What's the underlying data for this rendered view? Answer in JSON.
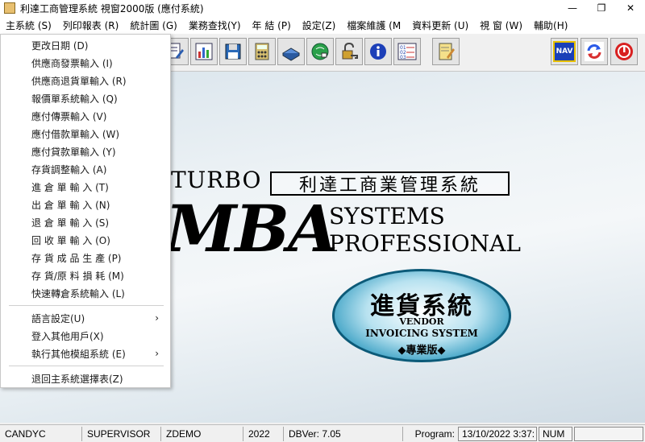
{
  "window": {
    "title": "利達工商管理系統 視窗2000版 (應付系統)",
    "minimize": "—",
    "maximize": "❐",
    "close": "✕"
  },
  "menubar": [
    "主系統 (S)",
    "列印報表 (R)",
    "統計圖 (G)",
    "業務查找(Y)",
    "年 結 (P)",
    "設定(Z)",
    "檔案維護 (M",
    "資料更新 (U)",
    "視 窗 (W)",
    "輔助(H)"
  ],
  "dropdown": {
    "items": [
      "更改日期 (D)",
      "供應商發票輸入 (I)",
      "供應商退貨單輸入 (R)",
      "報價單系統輸入 (Q)",
      "應付傳票輸入 (V)",
      "應付借款單輸入 (W)",
      "應付貸款單輸入 (Y)",
      "存貨調整輸入 (A)",
      "進 倉 單 輸 入 (T)",
      "出 倉 單 輸 入 (N)",
      "退 倉 單 輸 入 (S)",
      "回 收 單 輸 入 (O)",
      "存 貨 成 品 生 產 (P)",
      "存 貨/原 料 損 耗 (M)",
      "快速轉倉系統輸入 (L)"
    ],
    "sub_items": [
      "語言設定(U)",
      "登入其他用戶(X)",
      "執行其他模組系統 (E)"
    ],
    "last_item": "退回主系統選擇表(Z)",
    "submenu_arrow": "›"
  },
  "toolbar": {
    "icons": [
      "document-icon",
      "chart-icon",
      "diskette-icon",
      "calculator-icon",
      "printer-icon",
      "globe-icon",
      "lock-icon",
      "info-icon",
      "list-icon",
      "notepad-icon"
    ],
    "nav_label": "NAV",
    "right_icons": [
      "nav-icon",
      "refresh-icon",
      "exit-icon"
    ]
  },
  "splash": {
    "turbo": "TURBO",
    "cn_title": "利達工商業管理系統",
    "mba": "MBA",
    "systems": "SYSTEMS",
    "professional": "PROFESSIONAL",
    "module_cn": "進貨系統",
    "module_en1": "VENDOR",
    "module_en2": "INVOICING SYSTEM",
    "edition": "◆專業版◆"
  },
  "statusbar": {
    "user": "CANDYC",
    "role": "SUPERVISOR",
    "company": "ZDEMO",
    "year": "2022",
    "dbver": "DBVer: 7.05",
    "program_label": "Program:",
    "datetime": "13/10/2022 3:37:",
    "num": "NUM"
  }
}
